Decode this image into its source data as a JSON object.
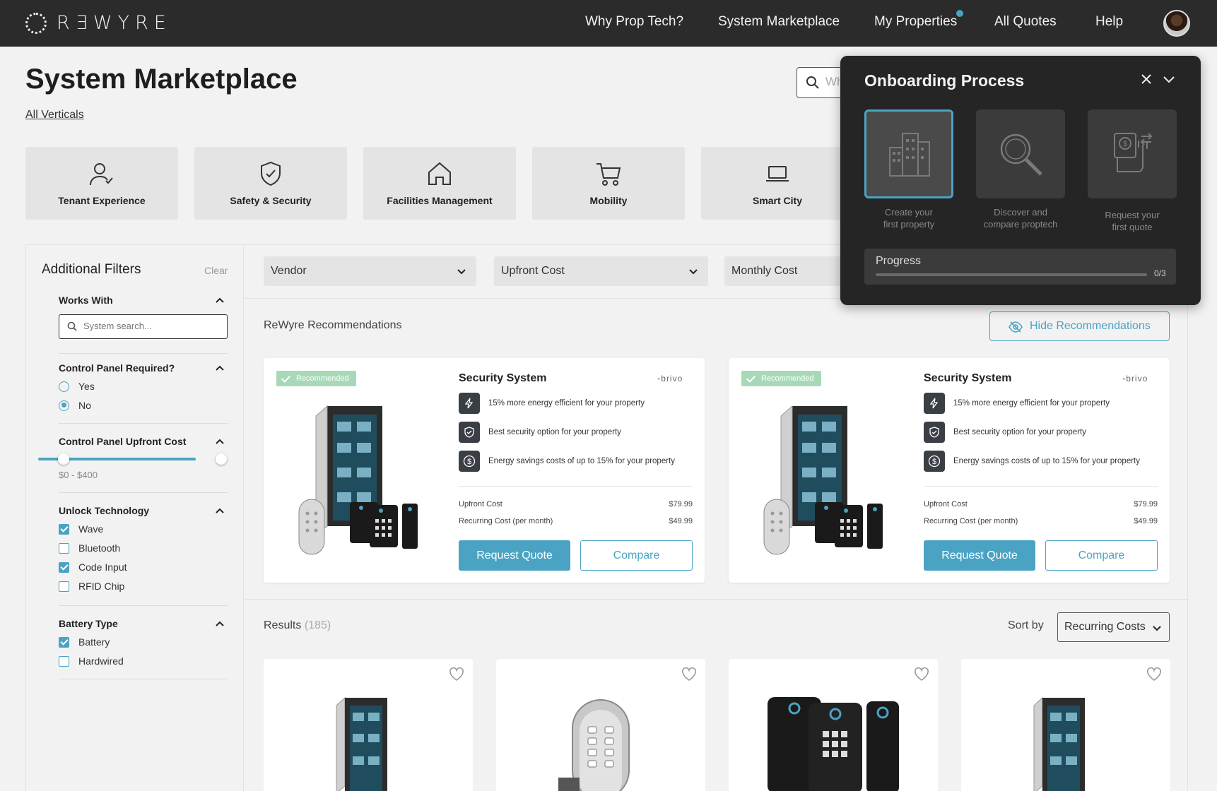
{
  "brand": {
    "logo_text": "RƎWYRE"
  },
  "nav": {
    "items": [
      "Why Prop Tech?",
      "System Marketplace",
      "My Properties",
      "All Quotes",
      "Help"
    ]
  },
  "page": {
    "title": "System Marketplace",
    "all_verticals": "All Verticals",
    "search_placeholder": "Wh"
  },
  "categories": [
    {
      "label": "Tenant Experience",
      "icon": "user-check-icon"
    },
    {
      "label": "Safety & Security",
      "icon": "shield-check-icon"
    },
    {
      "label": "Facilities Management",
      "icon": "house-icon"
    },
    {
      "label": "Mobility",
      "icon": "cart-icon"
    },
    {
      "label": "Smart City",
      "icon": "laptop-icon"
    }
  ],
  "filters": {
    "title": "Additional Filters",
    "clear": "Clear",
    "works_with": {
      "title": "Works With",
      "search_placeholder": "System search..."
    },
    "control_panel_required": {
      "title": "Control Panel Required?",
      "options": [
        {
          "label": "Yes",
          "selected": false
        },
        {
          "label": "No",
          "selected": true
        }
      ]
    },
    "control_panel_upfront_cost": {
      "title": "Control Panel Upfront Cost",
      "range": "$0 - $400"
    },
    "unlock_technology": {
      "title": "Unlock Technology",
      "options": [
        {
          "label": "Wave",
          "checked": true
        },
        {
          "label": "Bluetooth",
          "checked": false
        },
        {
          "label": "Code Input",
          "checked": true
        },
        {
          "label": "RFID Chip",
          "checked": false
        }
      ]
    },
    "battery_type": {
      "title": "Battery Type",
      "options": [
        {
          "label": "Battery",
          "checked": true
        },
        {
          "label": "Hardwired",
          "checked": false
        }
      ]
    }
  },
  "dropdowns": {
    "vendor": "Vendor",
    "upfront_cost": "Upfront Cost",
    "monthly_cost": "Monthly Cost"
  },
  "recommendations": {
    "title": "ReWyre Recommendations",
    "hide_label": "Hide Recommendations",
    "cards": [
      {
        "badge": "Recommended",
        "title": "Security System",
        "brand": "brivo",
        "features": [
          "15% more energy efficient for your property",
          "Best security option for your property",
          "Energy savings costs of up to 15% for your property"
        ],
        "upfront_label": "Upfront Cost",
        "upfront_value": "$79.99",
        "recurring_label": "Recurring Cost (per month)",
        "recurring_value": "$49.99",
        "request_label": "Request Quote",
        "compare_label": "Compare"
      },
      {
        "badge": "Recommended",
        "title": "Security System",
        "brand": "brivo",
        "features": [
          "15% more energy efficient for your property",
          "Best security option for your property",
          "Energy savings costs of up to 15% for your property"
        ],
        "upfront_label": "Upfront Cost",
        "upfront_value": "$79.99",
        "recurring_label": "Recurring Cost (per month)",
        "recurring_value": "$49.99",
        "request_label": "Request Quote",
        "compare_label": "Compare"
      }
    ]
  },
  "results": {
    "title": "Results",
    "count": "(185)",
    "sort_label": "Sort by",
    "sort_value": "Recurring Costs"
  },
  "onboarding": {
    "title": "Onboarding Process",
    "steps": [
      {
        "label_line1": "Create your",
        "label_line2": "first property",
        "icon": "buildings-icon",
        "active": true
      },
      {
        "label_line1": "Discover and",
        "label_line2": "compare proptech",
        "icon": "magnifier-icon",
        "active": false
      },
      {
        "label_line1": "Request your",
        "label_line2": "first quote",
        "icon": "hand-money-icon",
        "active": false
      }
    ],
    "progress_label": "Progress",
    "progress_count": "0/3",
    "progress_fraction": 0
  },
  "colors": {
    "accent": "#4ba3c3",
    "nav_bg": "#2b2b2b",
    "panel_bg": "#252525",
    "badge": "#a7d9b8"
  }
}
